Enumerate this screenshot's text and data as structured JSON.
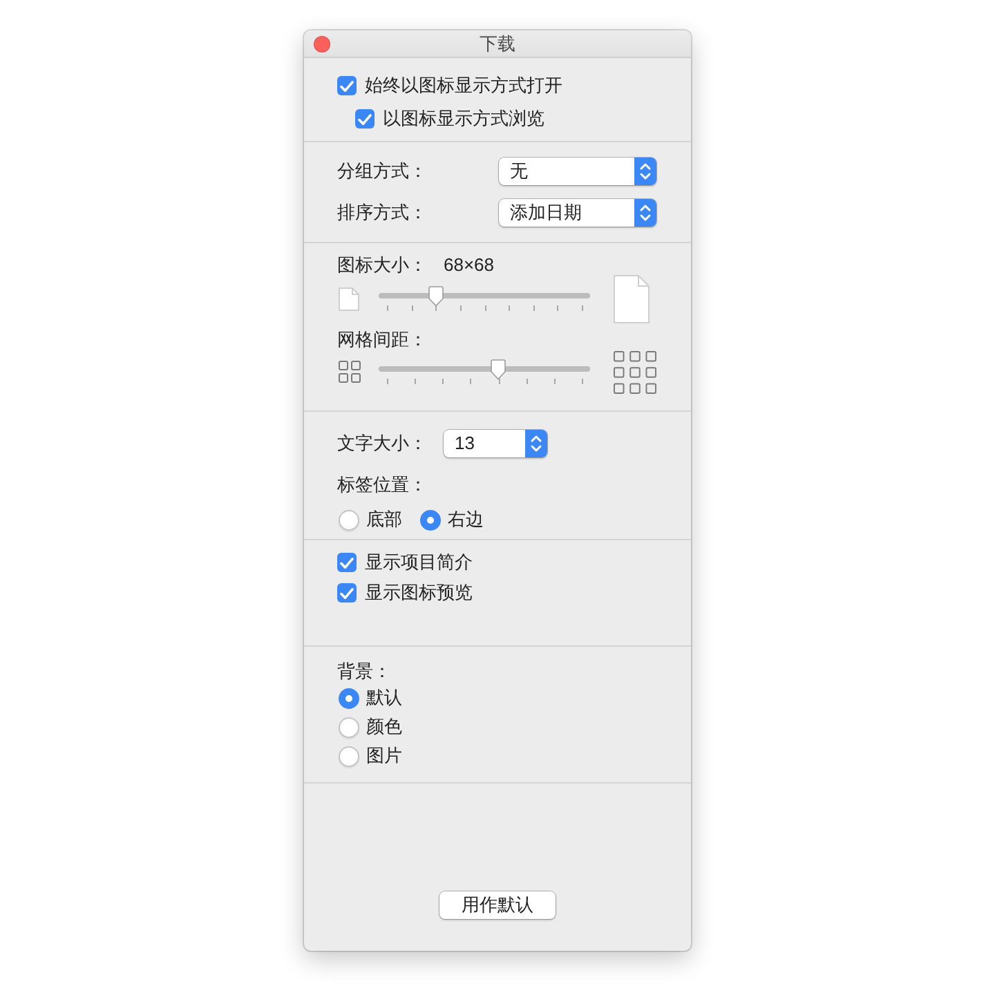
{
  "window": {
    "title": "下载"
  },
  "open_options": [
    {
      "label": "始终以图标显示方式打开",
      "checked": true,
      "children": [
        {
          "label": "以图标显示方式浏览",
          "checked": true
        }
      ]
    }
  ],
  "arrangement": [
    {
      "label": "分组方式：",
      "value": "无"
    },
    {
      "label": "排序方式：",
      "value": "添加日期"
    }
  ],
  "sliders": [
    {
      "kind": "icon-size",
      "label": "图标大小：",
      "reading": "68×68",
      "level": 0.25
    },
    {
      "kind": "grid-spacing",
      "label": "网格间距：",
      "level": 0.57
    }
  ],
  "text_size": {
    "label": "文字大小：",
    "value": "13"
  },
  "label_position": {
    "label": "标签位置：",
    "options": [
      {
        "label": "底部",
        "selected": false
      },
      {
        "label": "右边",
        "selected": true
      }
    ]
  },
  "show_options": [
    {
      "label": "显示项目简介",
      "checked": true
    },
    {
      "label": "显示图标预览",
      "checked": true
    }
  ],
  "background": {
    "label": "背景：",
    "options": [
      {
        "label": "默认",
        "selected": true
      },
      {
        "label": "颜色",
        "selected": false
      },
      {
        "label": "图片",
        "selected": false
      }
    ]
  },
  "buttons": [
    {
      "label": "用作默认"
    }
  ]
}
